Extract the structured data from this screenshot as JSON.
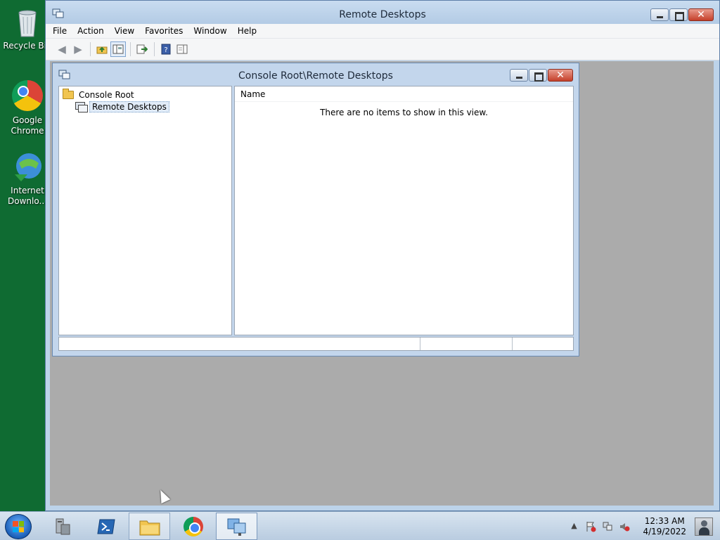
{
  "desktop": {
    "icons": [
      {
        "label": "Recycle Bin"
      },
      {
        "label": "Google\nChrome"
      },
      {
        "label": "Internet\nDownlo..."
      }
    ]
  },
  "main_window": {
    "title": "Remote Desktops",
    "menu": [
      "File",
      "Action",
      "View",
      "Favorites",
      "Window",
      "Help"
    ]
  },
  "child_window": {
    "title": "Console Root\\Remote Desktops",
    "tree": {
      "root": "Console Root",
      "child": "Remote Desktops"
    },
    "list": {
      "column_name": "Name",
      "empty_message": "There are no items to show in this view."
    }
  },
  "taskbar": {
    "clock_time": "12:33 AM",
    "clock_date": "4/19/2022"
  },
  "colors": {
    "desktop": "#0f6b32",
    "mdi_background": "#ababab",
    "window_frame": "#bcd3ea"
  }
}
